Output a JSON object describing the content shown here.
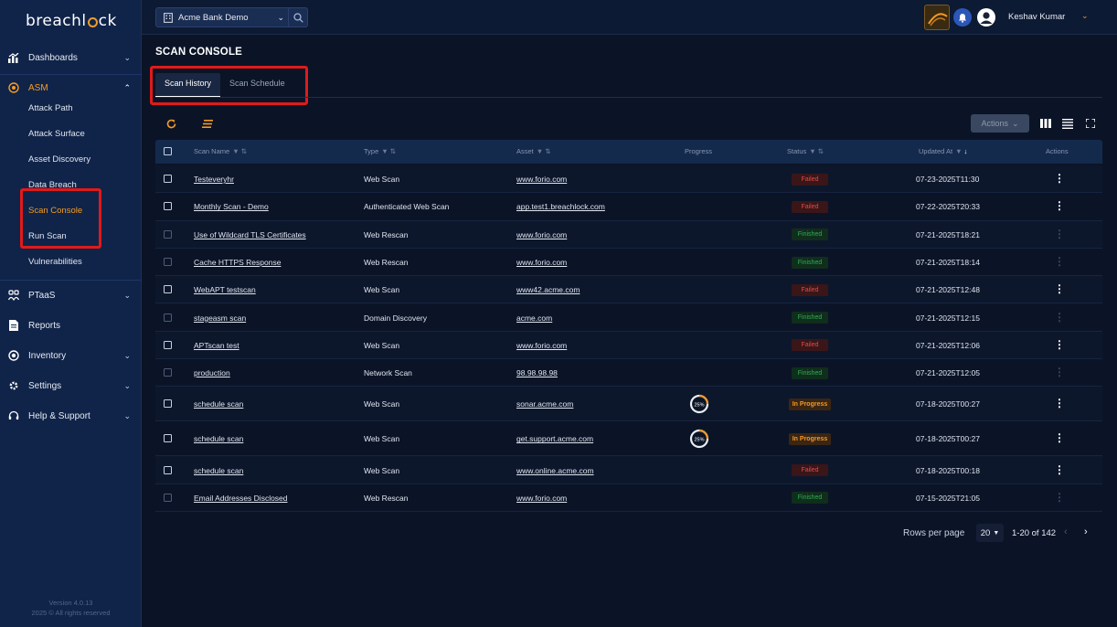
{
  "app": {
    "logo_text_a": "breachl",
    "logo_text_b": "ck",
    "version": "Version 4.0.13",
    "copyright": "2025 © All rights reserved"
  },
  "sidebar": {
    "dashboards": "Dashboards",
    "asm": "ASM",
    "asm_items": [
      "Attack Path",
      "Attack Surface",
      "Asset Discovery",
      "Data Breach",
      "Scan Console",
      "Run Scan",
      "Vulnerabilities"
    ],
    "ptaas": "PTaaS",
    "reports": "Reports",
    "inventory": "Inventory",
    "settings": "Settings",
    "help": "Help & Support"
  },
  "topbar": {
    "org": "Acme Bank Demo",
    "user": "Keshav Kumar"
  },
  "page": {
    "title": "SCAN CONSOLE",
    "tabs": [
      "Scan History",
      "Scan Schedule"
    ],
    "actions_label": "Actions"
  },
  "table": {
    "headers": {
      "name": "Scan Name",
      "type": "Type",
      "asset": "Asset",
      "progress": "Progress",
      "status": "Status",
      "updated": "Updated At",
      "actions": "Actions"
    },
    "rows": [
      {
        "name": "Testeveryhr",
        "type": "Web Scan",
        "asset": "www.forio.com",
        "status": "Failed",
        "updated": "07-23-2025T11:30",
        "progress": null
      },
      {
        "name": "Monthly Scan - Demo",
        "type": "Authenticated Web Scan",
        "asset": "app.test1.breachlock.com",
        "status": "Failed",
        "updated": "07-22-2025T20:33",
        "progress": null
      },
      {
        "name": "Use of Wildcard TLS Certificates",
        "type": "Web Rescan",
        "asset": "www.forio.com",
        "status": "Finished",
        "updated": "07-21-2025T18:21",
        "progress": null
      },
      {
        "name": "Cache HTTPS Response",
        "type": "Web Rescan",
        "asset": "www.forio.com",
        "status": "Finished",
        "updated": "07-21-2025T18:14",
        "progress": null
      },
      {
        "name": "WebAPT testscan",
        "type": "Web Scan",
        "asset": "www42.acme.com",
        "status": "Failed",
        "updated": "07-21-2025T12:48",
        "progress": null
      },
      {
        "name": "stageasm scan",
        "type": "Domain Discovery",
        "asset": "acme.com",
        "status": "Finished",
        "updated": "07-21-2025T12:15",
        "progress": null
      },
      {
        "name": "APTscan test",
        "type": "Web Scan",
        "asset": "www.forio.com",
        "status": "Failed",
        "updated": "07-21-2025T12:06",
        "progress": null
      },
      {
        "name": "production",
        "type": "Network Scan",
        "asset": "98.98.98.98",
        "status": "Finished",
        "updated": "07-21-2025T12:05",
        "progress": null
      },
      {
        "name": "schedule scan",
        "type": "Web Scan",
        "asset": "sonar.acme.com",
        "status": "In Progress",
        "updated": "07-18-2025T00:27",
        "progress": "25%"
      },
      {
        "name": "schedule scan",
        "type": "Web Scan",
        "asset": "get.support.acme.com",
        "status": "In Progress",
        "updated": "07-18-2025T00:27",
        "progress": "25%"
      },
      {
        "name": "schedule scan",
        "type": "Web Scan",
        "asset": "www.online.acme.com",
        "status": "Failed",
        "updated": "07-18-2025T00:18",
        "progress": null
      },
      {
        "name": "Email Addresses Disclosed",
        "type": "Web Rescan",
        "asset": "www.forio.com",
        "status": "Finished",
        "updated": "07-15-2025T21:05",
        "progress": null
      }
    ]
  },
  "pagination": {
    "label": "Rows per page",
    "per_page": "20",
    "range": "1-20 of 142"
  },
  "colors": {
    "accent": "#f59b23",
    "failed": "#e04b4b",
    "finished": "#2fae56",
    "in_progress": "#f2972a",
    "highlight": "#e11a1a"
  }
}
